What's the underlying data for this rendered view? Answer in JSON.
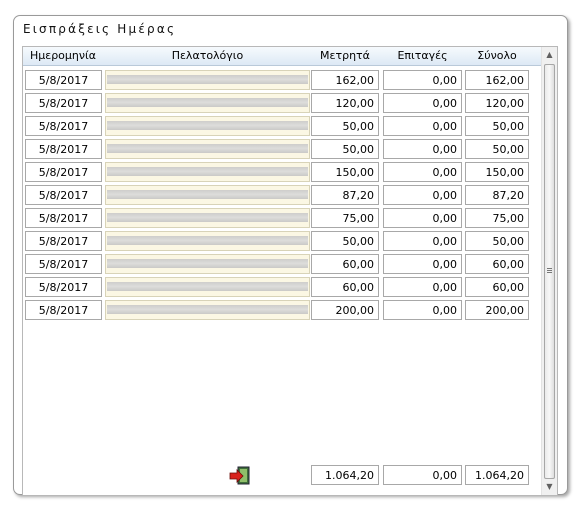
{
  "window": {
    "title": "Εισπράξεις Ημέρας"
  },
  "grid": {
    "columns": [
      "Ημερομηνία",
      "Πελατολόγιο",
      "Μετρητά",
      "Επιταγές",
      "Σύνολο"
    ],
    "rows": [
      {
        "date": "5/8/2017",
        "cash": "162,00",
        "checks": "0,00",
        "total": "162,00"
      },
      {
        "date": "5/8/2017",
        "cash": "120,00",
        "checks": "0,00",
        "total": "120,00"
      },
      {
        "date": "5/8/2017",
        "cash": "50,00",
        "checks": "0,00",
        "total": "50,00"
      },
      {
        "date": "5/8/2017",
        "cash": "50,00",
        "checks": "0,00",
        "total": "50,00"
      },
      {
        "date": "5/8/2017",
        "cash": "150,00",
        "checks": "0,00",
        "total": "150,00"
      },
      {
        "date": "5/8/2017",
        "cash": "87,20",
        "checks": "0,00",
        "total": "87,20"
      },
      {
        "date": "5/8/2017",
        "cash": "75,00",
        "checks": "0,00",
        "total": "75,00"
      },
      {
        "date": "5/8/2017",
        "cash": "50,00",
        "checks": "0,00",
        "total": "50,00"
      },
      {
        "date": "5/8/2017",
        "cash": "60,00",
        "checks": "0,00",
        "total": "60,00"
      },
      {
        "date": "5/8/2017",
        "cash": "60,00",
        "checks": "0,00",
        "total": "60,00"
      },
      {
        "date": "5/8/2017",
        "cash": "200,00",
        "checks": "0,00",
        "total": "200,00"
      }
    ],
    "totals": {
      "cash": "1.064,20",
      "checks": "0,00",
      "total": "1.064,20"
    }
  },
  "icons": {
    "exit": "exit-door-icon",
    "scroll_up": "arrow-up-icon",
    "scroll_down": "arrow-down-icon"
  }
}
